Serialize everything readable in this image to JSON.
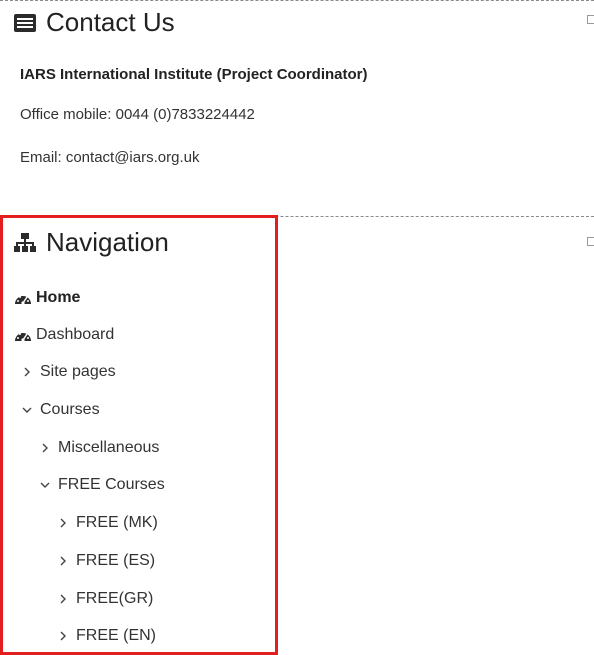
{
  "contact": {
    "title": "Contact Us",
    "org": "IARS International Institute (Project Coordinator)",
    "phone": "Office mobile: 0044 (0)7833224442",
    "email": "Email: contact@iars.org.uk"
  },
  "navigation": {
    "title": "Navigation",
    "items": [
      {
        "label": "Home",
        "icon": "dashboard-icon",
        "expand": "none",
        "level": 0,
        "bold": true
      },
      {
        "label": "Dashboard",
        "icon": "dashboard-icon",
        "expand": "none",
        "level": 0,
        "bold": false
      },
      {
        "label": "Site pages",
        "icon": "chevron-right-icon",
        "expand": "collapsed",
        "level": 0
      },
      {
        "label": "Courses",
        "icon": "chevron-down-icon",
        "expand": "expanded",
        "level": 0
      },
      {
        "label": "Miscellaneous",
        "icon": "chevron-right-icon",
        "expand": "collapsed",
        "level": 1
      },
      {
        "label": "FREE Courses",
        "icon": "chevron-down-icon",
        "expand": "expanded",
        "level": 1
      },
      {
        "label": "FREE (MK)",
        "icon": "chevron-right-icon",
        "expand": "collapsed",
        "level": 2
      },
      {
        "label": "FREE (ES)",
        "icon": "chevron-right-icon",
        "expand": "collapsed",
        "level": 2
      },
      {
        "label": "FREE(GR)",
        "icon": "chevron-right-icon",
        "expand": "collapsed",
        "level": 2
      },
      {
        "label": "FREE (EN)",
        "icon": "chevron-right-icon",
        "expand": "collapsed",
        "level": 2
      }
    ]
  },
  "colors": {
    "highlight": "#e21e1e",
    "text": "#333333",
    "border": "#8a8a8a"
  }
}
